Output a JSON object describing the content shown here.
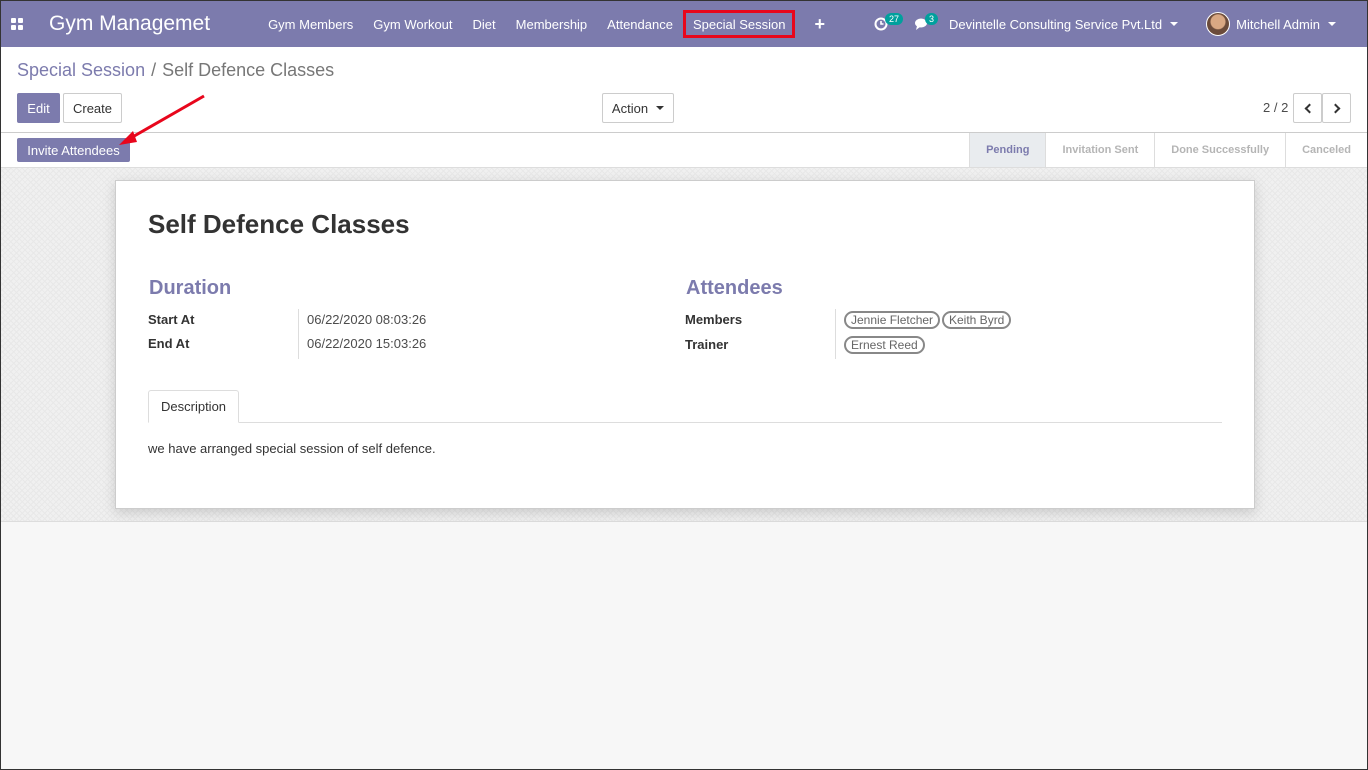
{
  "navbar": {
    "brand": "Gym Managemet",
    "menu": [
      {
        "label": "Gym Members"
      },
      {
        "label": "Gym Workout"
      },
      {
        "label": "Diet"
      },
      {
        "label": "Membership"
      },
      {
        "label": "Attendance"
      },
      {
        "label": "Special Session"
      }
    ],
    "plus_label": "+",
    "activity_count": "27",
    "messages_count": "3",
    "company": "Devintelle Consulting Service Pvt.Ltd",
    "user": "Mitchell Admin",
    "accent_color": "#7c7bad",
    "highlight_color": "#e8061c"
  },
  "breadcrumb": {
    "parent": "Special Session",
    "separator": "/",
    "current": "Self Defence Classes"
  },
  "toolbar": {
    "edit_label": "Edit",
    "create_label": "Create",
    "action_label": "Action",
    "pager_value": "2 / 2"
  },
  "statusbar": {
    "invite_label": "Invite Attendees",
    "stages": [
      "Pending",
      "Invitation Sent",
      "Done Successfully",
      "Canceled"
    ],
    "active_stage": "Pending"
  },
  "sheet": {
    "title": "Self Defence Classes",
    "duration": {
      "title": "Duration",
      "start_label": "Start At",
      "start_value": "06/22/2020 08:03:26",
      "end_label": "End At",
      "end_value": "06/22/2020 15:03:26"
    },
    "attendees": {
      "title": "Attendees",
      "members_label": "Members",
      "members": [
        "Jennie Fletcher",
        "Keith Byrd"
      ],
      "trainer_label": "Trainer",
      "trainer": "Ernest Reed"
    },
    "tab_label": "Description",
    "description": "we have arranged special session of self defence."
  }
}
